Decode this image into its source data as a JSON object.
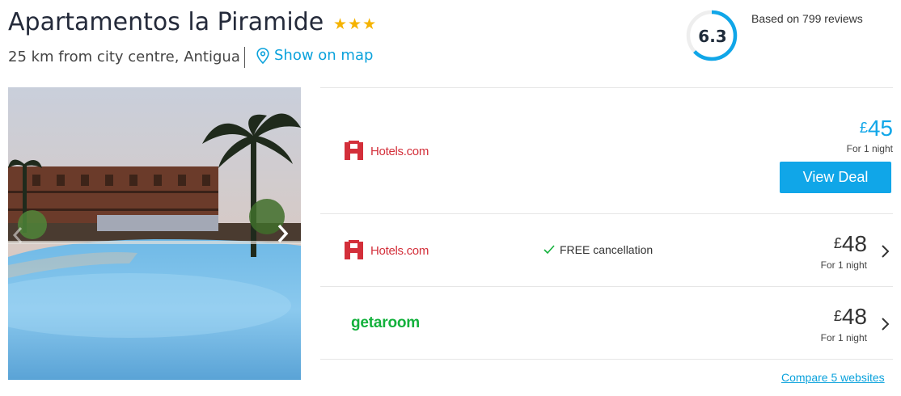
{
  "hotel": {
    "name": "Apartamentos la Piramide",
    "star_rating": 3,
    "location": "25 km from city centre, Antigua",
    "map_link": "Show on map"
  },
  "rating": {
    "score": "6.3",
    "score_fraction": 0.63,
    "reviews_text": "Based on 799 reviews",
    "ring_color": "#10a6e8"
  },
  "deals": [
    {
      "provider": "Hotels.com",
      "currency": "£",
      "amount": "45",
      "per_night": "For 1 night",
      "cta": "View Deal",
      "price_color": "#10a6e8"
    },
    {
      "provider": "Hotels.com",
      "feature": "FREE cancellation",
      "currency": "£",
      "amount": "48",
      "per_night": "For 1 night",
      "price_color": "#333333"
    },
    {
      "provider": "getaroom",
      "currency": "£",
      "amount": "48",
      "per_night": "For 1 night",
      "price_color": "#333333"
    }
  ],
  "compare_link": "Compare 5 websites",
  "icons": {
    "map": "map-pin-icon",
    "next": "chevron-right-icon",
    "prev": "chevron-left-icon",
    "check": "check-icon"
  }
}
